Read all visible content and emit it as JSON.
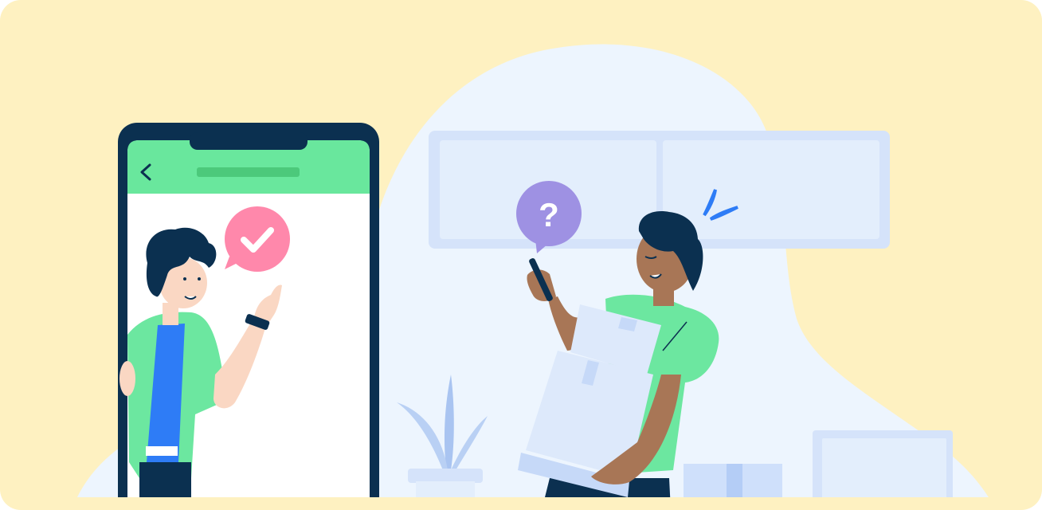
{
  "illustration": {
    "scene": "delivery-support",
    "colors": {
      "background": "#FEF1C1",
      "blob": "#EDF5FE",
      "phone_frame": "#0B3050",
      "app_header": "#69E79D",
      "header_bar": "#4CC97B",
      "shirt_green": "#6CE7A0",
      "check_bubble": "#FF88AB",
      "question_bubble": "#9E91E3",
      "sweat_drop": "#2E7CF6",
      "box": "#DDE9FB",
      "shelf": "#D5E3FA",
      "plant": "#A9C4F1",
      "skin_light": "#FAD7C3",
      "skin_dark": "#A87656",
      "hair": "#0B3050"
    },
    "icons": [
      "chevron-left-icon",
      "check-icon",
      "question-icon"
    ]
  }
}
